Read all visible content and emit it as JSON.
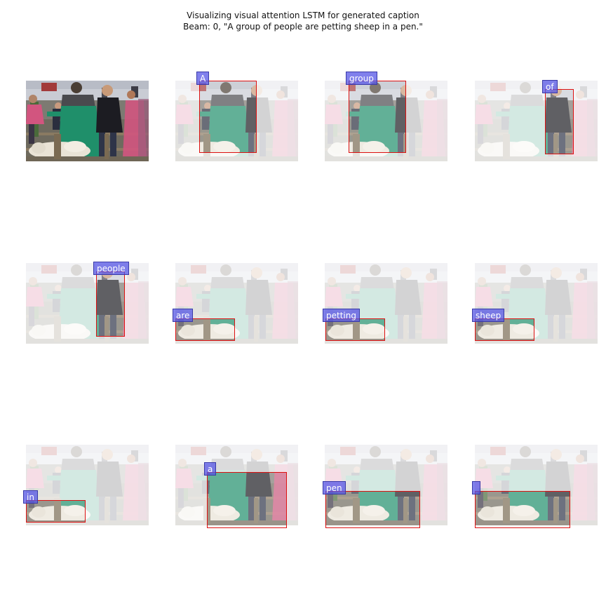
{
  "figure": {
    "title_line1": "Visualizing visual attention LSTM for generated caption",
    "title_line2": "Beam: 0, \"A group of people are petting sheep in a pen.\""
  },
  "panels": [
    {
      "word": "",
      "is_original": true
    },
    {
      "word": "A"
    },
    {
      "word": "group"
    },
    {
      "word": "of"
    },
    {
      "word": "people"
    },
    {
      "word": "are"
    },
    {
      "word": "petting"
    },
    {
      "word": "sheep"
    },
    {
      "word": "in"
    },
    {
      "word": "a"
    },
    {
      "word": "pen"
    },
    {
      "word": ""
    }
  ],
  "colors": {
    "attention_box": "#dd1111",
    "label_background": "#5555e6",
    "jacket_green": "#1f8f6a",
    "jacket_dark": "#1c1c22",
    "girl_pink": "#d2557f",
    "sheep_wool": "#e9e3d6"
  }
}
